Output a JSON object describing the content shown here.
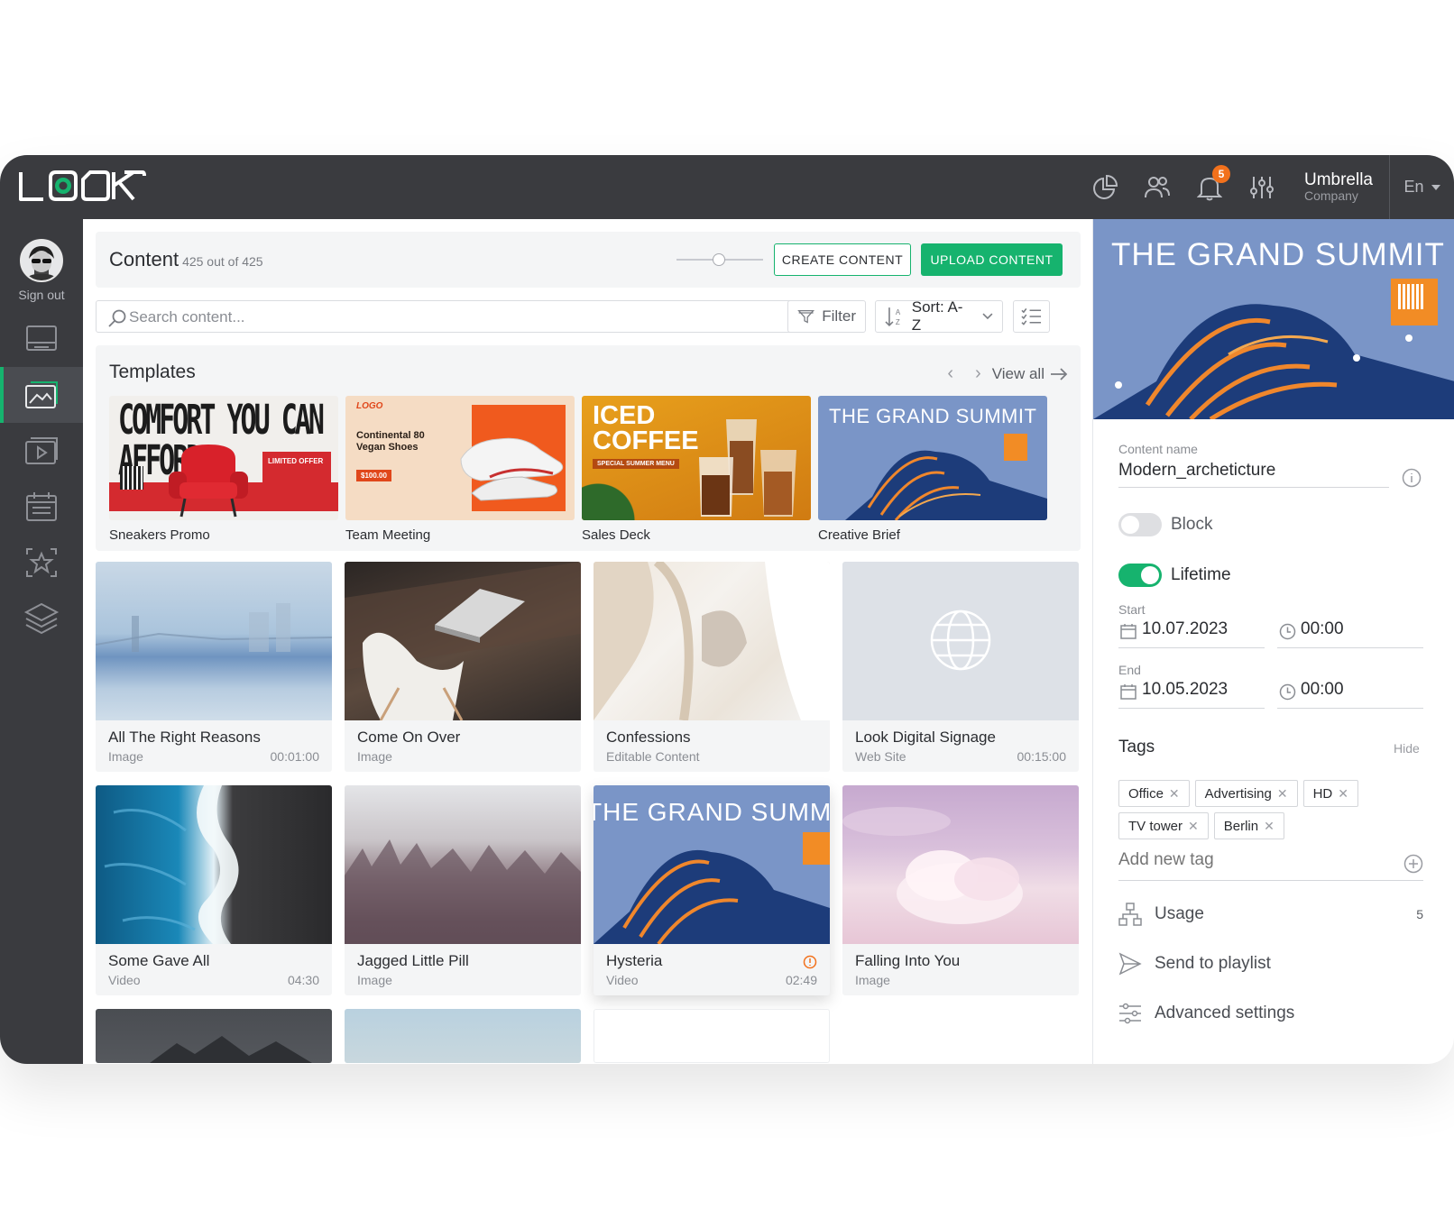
{
  "app": {
    "logo_text": "LOOK"
  },
  "topbar": {
    "notifications_count": "5",
    "company_name": "Umbrella",
    "company_sub": "Company",
    "language": "En"
  },
  "sidebar": {
    "sign_out": "Sign out",
    "items": [
      {
        "icon": "screens-icon"
      },
      {
        "icon": "content-icon",
        "active": true
      },
      {
        "icon": "playlist-icon"
      },
      {
        "icon": "schedule-icon"
      },
      {
        "icon": "favorites-icon"
      },
      {
        "icon": "layers-icon"
      }
    ]
  },
  "header": {
    "title": "Content",
    "count": "425 out of 425",
    "create_label": "CREATE CONTENT",
    "upload_label": "UPLOAD CONTENT"
  },
  "toolbar": {
    "search_placeholder": "Search content...",
    "filter_label": "Filter",
    "sort_label": "Sort: A-Z"
  },
  "templates": {
    "title": "Templates",
    "view_all": "View all",
    "items": [
      {
        "label": "Sneakers Promo",
        "thumb_text": "COMFORT YOU CAN AFFORD",
        "badge": "LIMITED OFFER"
      },
      {
        "label": "Team Meeting",
        "thumb_text": "Continental 80 Vegan Shoes",
        "logo": "LOGO",
        "price": "$100.00"
      },
      {
        "label": "Sales Deck",
        "thumb_text": "ICED COFFEE",
        "sub": "SPECIAL SUMMER MENU"
      },
      {
        "label": "Creative Brief",
        "thumb_text": "THE GRAND SUMMIT"
      }
    ]
  },
  "content_items": [
    {
      "name": "All The Right Reasons",
      "type": "Image",
      "duration": "00:01:00"
    },
    {
      "name": "Come On Over",
      "type": "Image",
      "duration": ""
    },
    {
      "name": "Confessions",
      "type": "Editable Content",
      "duration": ""
    },
    {
      "name": "Look Digital Signage",
      "type": "Web Site",
      "duration": "00:15:00"
    },
    {
      "name": "Some Gave All",
      "type": "Video",
      "duration": "04:30"
    },
    {
      "name": "Jagged Little Pill",
      "type": "Image",
      "duration": ""
    },
    {
      "name": "Hysteria",
      "type": "Video",
      "duration": "02:49",
      "overlay": "THE GRAND SUMMIT"
    },
    {
      "name": "Falling Into You",
      "type": "Image",
      "duration": ""
    }
  ],
  "details": {
    "hero_title": "THE GRAND SUMMIT",
    "content_name_label": "Content name",
    "content_name": "Modern_archeticture",
    "block_label": "Block",
    "block_on": false,
    "lifetime_label": "Lifetime",
    "lifetime_on": true,
    "start_label": "Start",
    "start_date": "10.07.2023",
    "start_time": "00:00",
    "end_label": "End",
    "end_date": "10.05.2023",
    "end_time": "00:00",
    "tags_label": "Tags",
    "tags_hide": "Hide",
    "tags": [
      "Office",
      "Advertising",
      "HD",
      "TV tower",
      "Berlin"
    ],
    "add_tag_placeholder": "Add new tag",
    "usage_label": "Usage",
    "usage_count": "5",
    "send_label": "Send to playlist",
    "advanced_label": "Advanced settings"
  },
  "colors": {
    "accent": "#16b36e",
    "dark": "#3a3b3f",
    "badge": "#f2711c"
  }
}
